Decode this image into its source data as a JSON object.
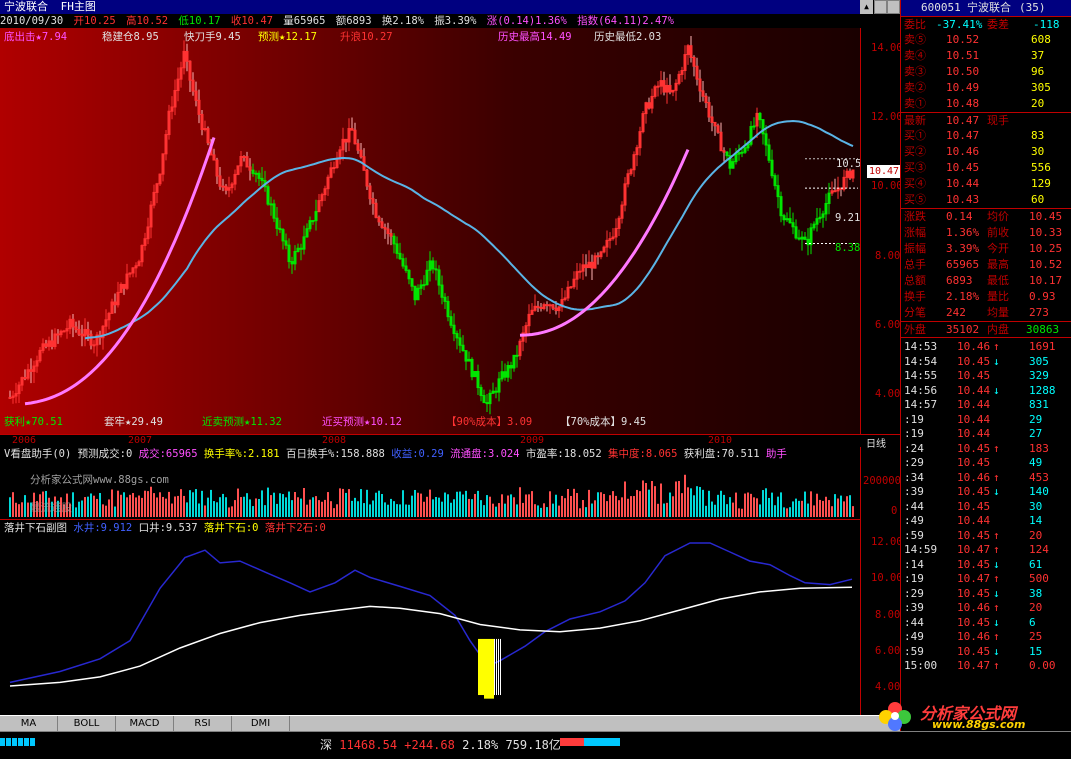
{
  "window": {
    "title": "宁波联合",
    "subtitle": "FH主图"
  },
  "quote": {
    "date": "2010/09/30",
    "open": "开10.25",
    "high": "高10.52",
    "low": "低10.17",
    "close": "收10.47",
    "volume": "量65965",
    "amount": "额6893",
    "turnover": "换2.18%",
    "amplitude": "振3.39%",
    "change": "涨(0.14)1.36%",
    "index": "指数(64.11)2.47%"
  },
  "main_indicators": {
    "bottom_buy": "底出击★7.94",
    "stable_build": "稳建仓8.95",
    "quick_knife": "快刀手9.45",
    "forecast": "预测★12.17",
    "rise_wave": "升浪10.27",
    "hist_high": "历史最高14.49",
    "hist_low": "历史最低2.03",
    "profit": "获利★70.51",
    "trapped": "套牢★29.49",
    "near_sell": "近卖预测★11.32",
    "near_buy": "近买预测★10.12",
    "cost90": "【90%成本】3.09",
    "cost70": "【70%成本】9.45"
  },
  "main_chart_labels": {
    "y_ticks": [
      "14.00",
      "12.00",
      "10.00",
      "8.00",
      "6.00",
      "4.00"
    ],
    "price_tag": "10.47",
    "level_a": "9.21",
    "level_b": "8.38",
    "level_c": "10.5"
  },
  "time_axis": {
    "labels": [
      "2006",
      "2007",
      "2008",
      "2009",
      "2010"
    ],
    "period": "日线"
  },
  "vol_panel": {
    "title": "V看盘助手(0)",
    "items": [
      "预测成交:0",
      "成交:65965",
      "换手率%:2.181",
      "百日换手%:158.888",
      "收益:0.29",
      "流通盘:3.024",
      "市盈率:18.052",
      "集中度:8.065",
      "获利盘:70.511",
      "助手"
    ],
    "watermark1": "分析家公式网www.88gs.com",
    "watermark2": "最流通股",
    "y_ticks": [
      "200000",
      "0"
    ]
  },
  "sub_panel": {
    "title": "落井下石副图",
    "items": [
      "水井:9.912",
      "口井:9.537",
      "落井下石:0",
      "落井下2石:0"
    ],
    "y_ticks": [
      "12.00",
      "10.00",
      "8.00",
      "6.00",
      "4.00"
    ]
  },
  "tabs": [
    "MA",
    "BOLL",
    "MACD",
    "RSI",
    "DMI"
  ],
  "status": {
    "market": "深",
    "index_value": "11468.54",
    "index_change": "+244.68",
    "index_pct": "2.18%",
    "turnover": "759.18亿"
  },
  "right_panel": {
    "code": "600051",
    "name": "宁波联合",
    "count": "(35)",
    "ratio_label": "委比",
    "ratio_value": "-37.41%",
    "diff_label": "委差",
    "diff_value": "-118",
    "asks": [
      {
        "label": "卖⑤",
        "price": "10.52",
        "vol": "608"
      },
      {
        "label": "卖④",
        "price": "10.51",
        "vol": "37"
      },
      {
        "label": "卖③",
        "price": "10.50",
        "vol": "96"
      },
      {
        "label": "卖②",
        "price": "10.49",
        "vol": "305"
      },
      {
        "label": "卖①",
        "price": "10.48",
        "vol": "20"
      }
    ],
    "last_label": "最新",
    "last_price": "10.47",
    "now_label": "现手",
    "bids": [
      {
        "label": "买①",
        "price": "10.47",
        "vol": "83"
      },
      {
        "label": "买②",
        "price": "10.46",
        "vol": "30"
      },
      {
        "label": "买③",
        "price": "10.45",
        "vol": "556"
      },
      {
        "label": "买④",
        "price": "10.44",
        "vol": "129"
      },
      {
        "label": "买⑤",
        "price": "10.43",
        "vol": "60"
      }
    ],
    "stats": [
      {
        "l1": "涨跌",
        "v1": "0.14",
        "l2": "均价",
        "v2": "10.45"
      },
      {
        "l1": "涨幅",
        "v1": "1.36%",
        "l2": "前收",
        "v2": "10.33"
      },
      {
        "l1": "振幅",
        "v1": "3.39%",
        "l2": "今开",
        "v2": "10.25"
      },
      {
        "l1": "总手",
        "v1": "65965",
        "l2": "最高",
        "v2": "10.52"
      },
      {
        "l1": "总额",
        "v1": "6893",
        "l2": "最低",
        "v2": "10.17"
      },
      {
        "l1": "换手",
        "v1": "2.18%",
        "l2": "量比",
        "v2": "0.93"
      },
      {
        "l1": "分笔",
        "v1": "242",
        "l2": "均量",
        "v2": "273"
      }
    ],
    "outer_label": "外盘",
    "outer_value": "35102",
    "inner_label": "内盘",
    "inner_value": "30863",
    "ticks": [
      {
        "t": "14:53",
        "p": "10.46",
        "d": "↑",
        "v": "1691",
        "pc": "red",
        "vc": "red"
      },
      {
        "t": "14:54",
        "p": "10.45",
        "d": "↓",
        "v": "305",
        "pc": "red",
        "vc": "cyan"
      },
      {
        "t": "14:55",
        "p": "10.45",
        "d": "",
        "v": "329",
        "pc": "red",
        "vc": "cyan"
      },
      {
        "t": "14:56",
        "p": "10.44",
        "d": "↓",
        "v": "1288",
        "pc": "red",
        "vc": "cyan"
      },
      {
        "t": "14:57",
        "p": "10.44",
        "d": "",
        "v": "831",
        "pc": "red",
        "vc": "cyan"
      },
      {
        "t": ":19",
        "p": "10.44",
        "d": "",
        "v": "29",
        "pc": "red",
        "vc": "cyan"
      },
      {
        "t": ":19",
        "p": "10.44",
        "d": "",
        "v": "27",
        "pc": "red",
        "vc": "cyan"
      },
      {
        "t": ":24",
        "p": "10.45",
        "d": "↑",
        "v": "183",
        "pc": "red",
        "vc": "red"
      },
      {
        "t": ":29",
        "p": "10.45",
        "d": "",
        "v": "49",
        "pc": "red",
        "vc": "cyan"
      },
      {
        "t": ":34",
        "p": "10.46",
        "d": "↑",
        "v": "453",
        "pc": "red",
        "vc": "red"
      },
      {
        "t": ":39",
        "p": "10.45",
        "d": "↓",
        "v": "140",
        "pc": "red",
        "vc": "cyan"
      },
      {
        "t": ":44",
        "p": "10.45",
        "d": "",
        "v": "30",
        "pc": "red",
        "vc": "cyan"
      },
      {
        "t": ":49",
        "p": "10.44",
        "d": "",
        "v": "14",
        "pc": "red",
        "vc": "cyan"
      },
      {
        "t": ":59",
        "p": "10.45",
        "d": "↑",
        "v": "20",
        "pc": "red",
        "vc": "red"
      },
      {
        "t": "14:59",
        "p": "10.47",
        "d": "↑",
        "v": "124",
        "pc": "red",
        "vc": "red"
      },
      {
        "t": ":14",
        "p": "10.45",
        "d": "↓",
        "v": "61",
        "pc": "red",
        "vc": "cyan"
      },
      {
        "t": ":19",
        "p": "10.47",
        "d": "↑",
        "v": "500",
        "pc": "red",
        "vc": "red"
      },
      {
        "t": ":29",
        "p": "10.45",
        "d": "↓",
        "v": "38",
        "pc": "red",
        "vc": "cyan"
      },
      {
        "t": ":39",
        "p": "10.46",
        "d": "↑",
        "v": "20",
        "pc": "red",
        "vc": "red"
      },
      {
        "t": ":44",
        "p": "10.45",
        "d": "↓",
        "v": "6",
        "pc": "red",
        "vc": "cyan"
      },
      {
        "t": ":49",
        "p": "10.46",
        "d": "↑",
        "v": "25",
        "pc": "red",
        "vc": "red"
      },
      {
        "t": ":59",
        "p": "10.45",
        "d": "↓",
        "v": "15",
        "pc": "red",
        "vc": "cyan"
      },
      {
        "t": "15:00",
        "p": "10.47",
        "d": "↑",
        "v": "0.00",
        "pc": "red",
        "vc": "red"
      }
    ]
  },
  "logo": {
    "text": "分析家公式网",
    "url": "www.88gs.com"
  },
  "colors": {
    "up": "#ff3232",
    "down": "#00e600",
    "ma_cyan": "#5ab4e6",
    "ma_pink": "#ff78ff",
    "axis": "#c00000"
  }
}
